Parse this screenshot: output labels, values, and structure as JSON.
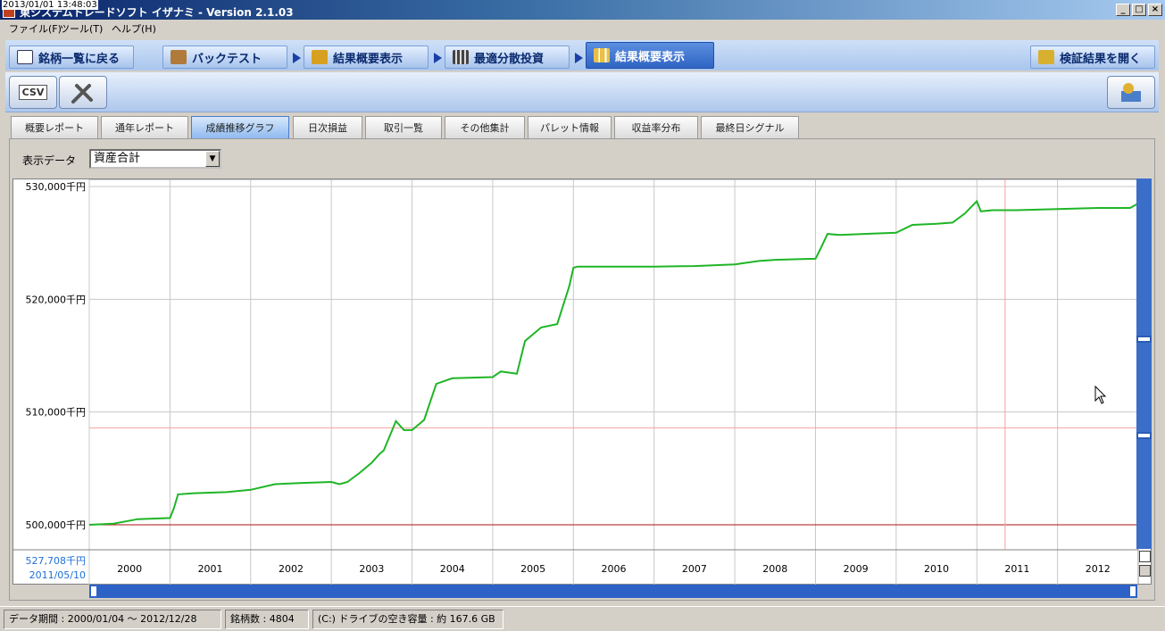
{
  "window": {
    "timestamp": "2013/01/01 13:48:03",
    "title": "東システムトレードソフト イザナミ - Version 2.1.03",
    "controls": [
      "_",
      "□",
      "×"
    ]
  },
  "menu": [
    "ファイル(F)",
    "ツール(T)",
    "ヘルプ(H)"
  ],
  "nav_tabs": [
    {
      "label": "銘柄一覧に戻る",
      "icon": "eye-icon"
    },
    {
      "label": "バックテスト",
      "icon": "bag-icon"
    },
    {
      "label": "結果概要表示",
      "icon": "chart-icon"
    },
    {
      "label": "最適分散投資",
      "icon": "calculator-icon"
    },
    {
      "label": "結果概要表示",
      "icon": "bar-chart-icon",
      "active": true
    },
    {
      "label": "検証結果を開く",
      "icon": "open-result-icon"
    }
  ],
  "toolbar": {
    "csv_label": "CSV"
  },
  "sub_tabs": [
    "概要レポート",
    "通年レポート",
    "成績推移グラフ",
    "日次損益",
    "取引一覧",
    "その他集計",
    "パレット情報",
    "収益率分布",
    "最終日シグナル"
  ],
  "active_sub_tab": 2,
  "display": {
    "label": "表示データ",
    "value": "資産合計"
  },
  "cursor_info": {
    "value": "527,708千円",
    "date": "2011/05/10"
  },
  "status": {
    "period": "データ期間 : 2000/01/04 〜 2012/12/28",
    "stocks": "銘柄数 : 4804",
    "disk": "(C:) ドライブの空き容量 : 約 167.6 GB"
  },
  "colors": {
    "series": "#1fb526",
    "baseline": "#b01010",
    "crosshair": "#f4a0a0",
    "grid": "#c8c8c8"
  },
  "chart_data": {
    "type": "line",
    "y_ticks": [
      "500,000千円",
      "510,000千円",
      "520,000千円",
      "530,000千円"
    ],
    "x_ticks": [
      "2000",
      "2001",
      "2002",
      "2003",
      "2004",
      "2005",
      "2006",
      "2007",
      "2008",
      "2009",
      "2010",
      "2011",
      "2012"
    ],
    "ylim": [
      500000,
      530000
    ],
    "xlim": [
      2000.0,
      2013.0
    ],
    "baseline": 500000,
    "crosshair": {
      "x": 2011.35,
      "y": 508600
    },
    "series": [
      {
        "x": [
          2000.0,
          2000.3,
          2000.6,
          2001.0,
          2001.05,
          2001.1,
          2001.3,
          2001.7,
          2002.0,
          2002.3,
          2002.6,
          2003.0,
          2003.1,
          2003.2,
          2003.35,
          2003.5,
          2003.6,
          2003.65,
          2003.8,
          2003.9,
          2004.0,
          2004.15,
          2004.3,
          2004.5,
          2005.0,
          2005.1,
          2005.3,
          2005.4,
          2005.6,
          2005.8,
          2005.95,
          2006.0,
          2006.05,
          2006.2,
          2007.0,
          2007.5,
          2008.0,
          2008.3,
          2008.5,
          2009.0,
          2009.05,
          2009.15,
          2009.3,
          2009.6,
          2010.0,
          2010.2,
          2010.5,
          2010.7,
          2010.85,
          2011.0,
          2011.05,
          2011.2,
          2011.5,
          2012.0,
          2012.5,
          2012.9,
          2013.0
        ],
        "y": [
          500000,
          500100,
          500500,
          500600,
          501500,
          502700,
          502800,
          502900,
          503100,
          503600,
          503700,
          503800,
          503600,
          503800,
          504600,
          505500,
          506300,
          506600,
          509200,
          508400,
          508400,
          509300,
          512500,
          513000,
          513100,
          513600,
          513400,
          516300,
          517500,
          517800,
          521200,
          522800,
          522900,
          522900,
          522900,
          522950,
          523100,
          523400,
          523500,
          523600,
          524300,
          525800,
          525700,
          525800,
          525900,
          526600,
          526700,
          526800,
          527600,
          528700,
          527800,
          527900,
          527900,
          528000,
          528100,
          528100,
          528500
        ]
      }
    ]
  }
}
